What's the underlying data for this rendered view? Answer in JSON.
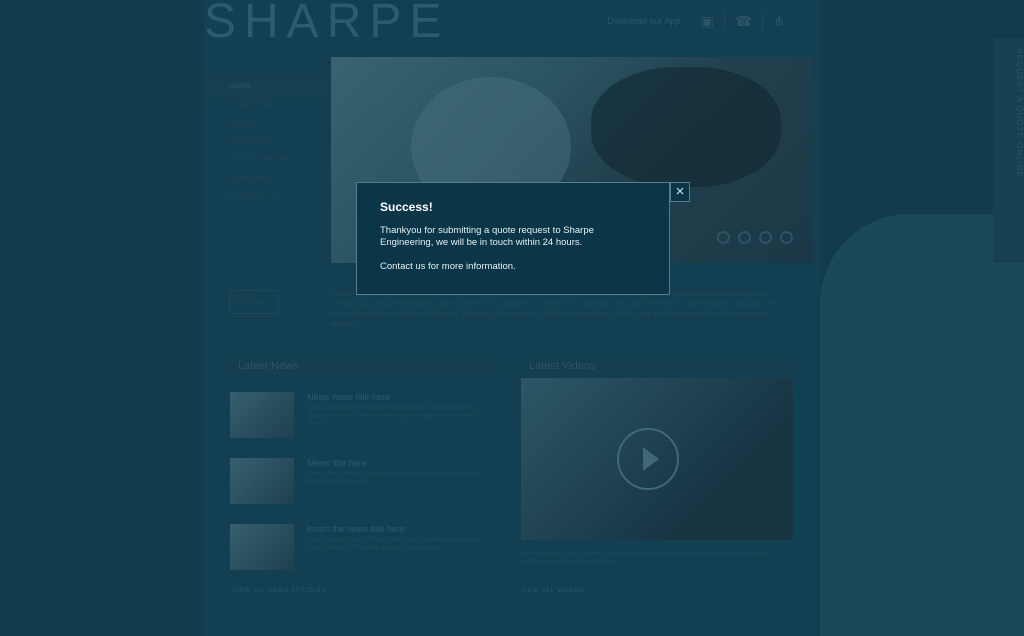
{
  "brand": {
    "logo": "SHARPE"
  },
  "topbar": {
    "download_label": "Download our App",
    "apple_icon": "apple-icon",
    "android_icon": "android-icon",
    "phone_icon": "phone-icon",
    "share_icon": "share-icon"
  },
  "nav": {
    "items": [
      {
        "label": "HOME"
      },
      {
        "label": "EXPERTISE"
      },
      {
        "label": "QUALITY"
      },
      {
        "label": "FACILITIES"
      },
      {
        "label": "ABOUT SHARPE"
      },
      {
        "label": "PARTNERS"
      },
      {
        "label": "CONTACT US"
      }
    ]
  },
  "side_tab": {
    "label": "REQUEST A QUOTE ONLINE"
  },
  "badge": {
    "label": "QUOTE ENGINEERING"
  },
  "intro": {
    "text": "Sharpe ipsum dolor sit amet consectetur adipiscing elit sed do eiusmod tempor incididunt ut labore et dolore magna aliqua. Ut enim ad minim veniam quis nostrud exercitation ullamco laboris nisi ut aliquip ex ea commodo consequat. Duis aute irure dolor in reprehenderit in voluptate velit esse cillum dolore eu fugiat nulla pariatur. Excepteur sint occaecat cupidatat non proident, sunt in culpa qui officia deserunt mollit anim id est laborum."
  },
  "news": {
    "title": "Latest News",
    "items": [
      {
        "title": "News news title here",
        "text": "Donec mols blanis omnibus aliquam lectus ut quis et lorem aliqu et tellus mi imperdet ullamcorper dapibus consectetur lacus."
      },
      {
        "title": "News title here",
        "text": "Donec mols blanis adipiscing veltus mauris et lectus quisque ullamcorper imperdet."
      },
      {
        "title": "Insert the news title here",
        "text": "qui et laburiunt ulum. Donec mols blanis omnibus aliquam ut quis et tellus mi imperdet dapibus consectetur."
      }
    ],
    "view_all": "VIEW ALL NEWS ARTICLES"
  },
  "videos": {
    "title": "Latest Videos",
    "text": "qui et laburiunt ulum. Donec mols blanis omnibus aliquam ut quis et tellus mi imperdet dapibus consectetur lacus mauris.",
    "view_all": "VIEW ALL VIDEOS"
  },
  "modal": {
    "title": "Success!",
    "message": "Thankyou for submitting a quote request to Sharpe Engineering, we will be in touch within 24 hours.",
    "contact": "Contact us for more information.",
    "close_glyph": "×"
  }
}
